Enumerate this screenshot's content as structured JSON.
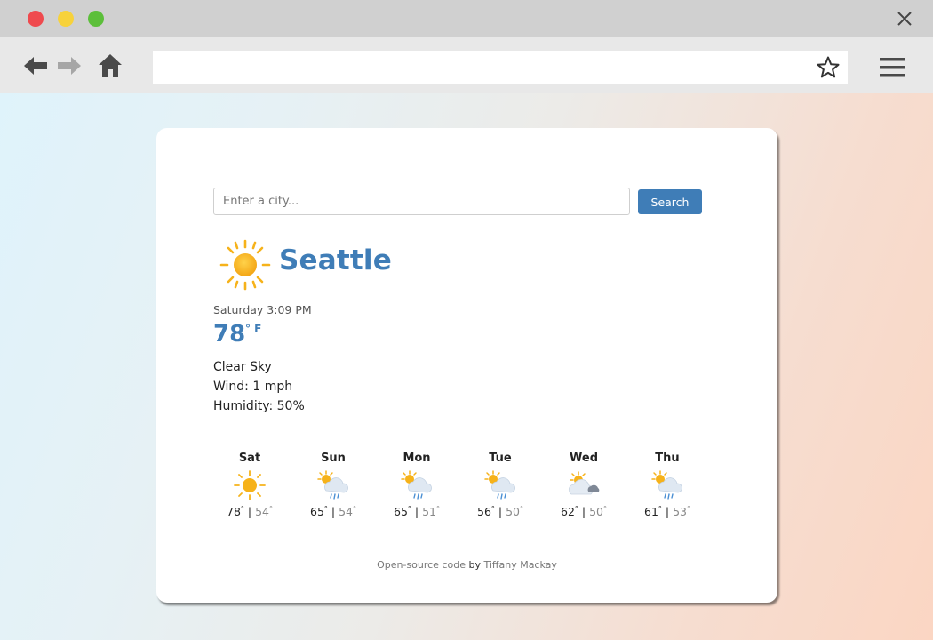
{
  "browser": {
    "address_value": ""
  },
  "search": {
    "placeholder": "Enter a city...",
    "button_label": "Search"
  },
  "weather": {
    "city": "Seattle",
    "datetime": "Saturday 3:09 PM",
    "temperature": "78",
    "unit": "° F",
    "description": "Clear Sky",
    "wind": "Wind: 1 mph",
    "humidity": "Humidity: 50%",
    "icon": "sun-icon"
  },
  "forecast": [
    {
      "day": "Sat",
      "icon": "sun-icon",
      "high": "78",
      "low": "54"
    },
    {
      "day": "Sun",
      "icon": "sun-rain-icon",
      "high": "65",
      "low": "54"
    },
    {
      "day": "Mon",
      "icon": "sun-rain-icon",
      "high": "65",
      "low": "51"
    },
    {
      "day": "Tue",
      "icon": "sun-rain-icon",
      "high": "56",
      "low": "50"
    },
    {
      "day": "Wed",
      "icon": "partly-cloudy-icon",
      "high": "62",
      "low": "50"
    },
    {
      "day": "Thu",
      "icon": "sun-rain-icon",
      "high": "61",
      "low": "53"
    }
  ],
  "footer": {
    "link_text": "Open-source code",
    "by": " by ",
    "author": "Tiffany Mackay"
  },
  "colors": {
    "accent": "#3f7db7",
    "sun": "#f6b21a"
  }
}
